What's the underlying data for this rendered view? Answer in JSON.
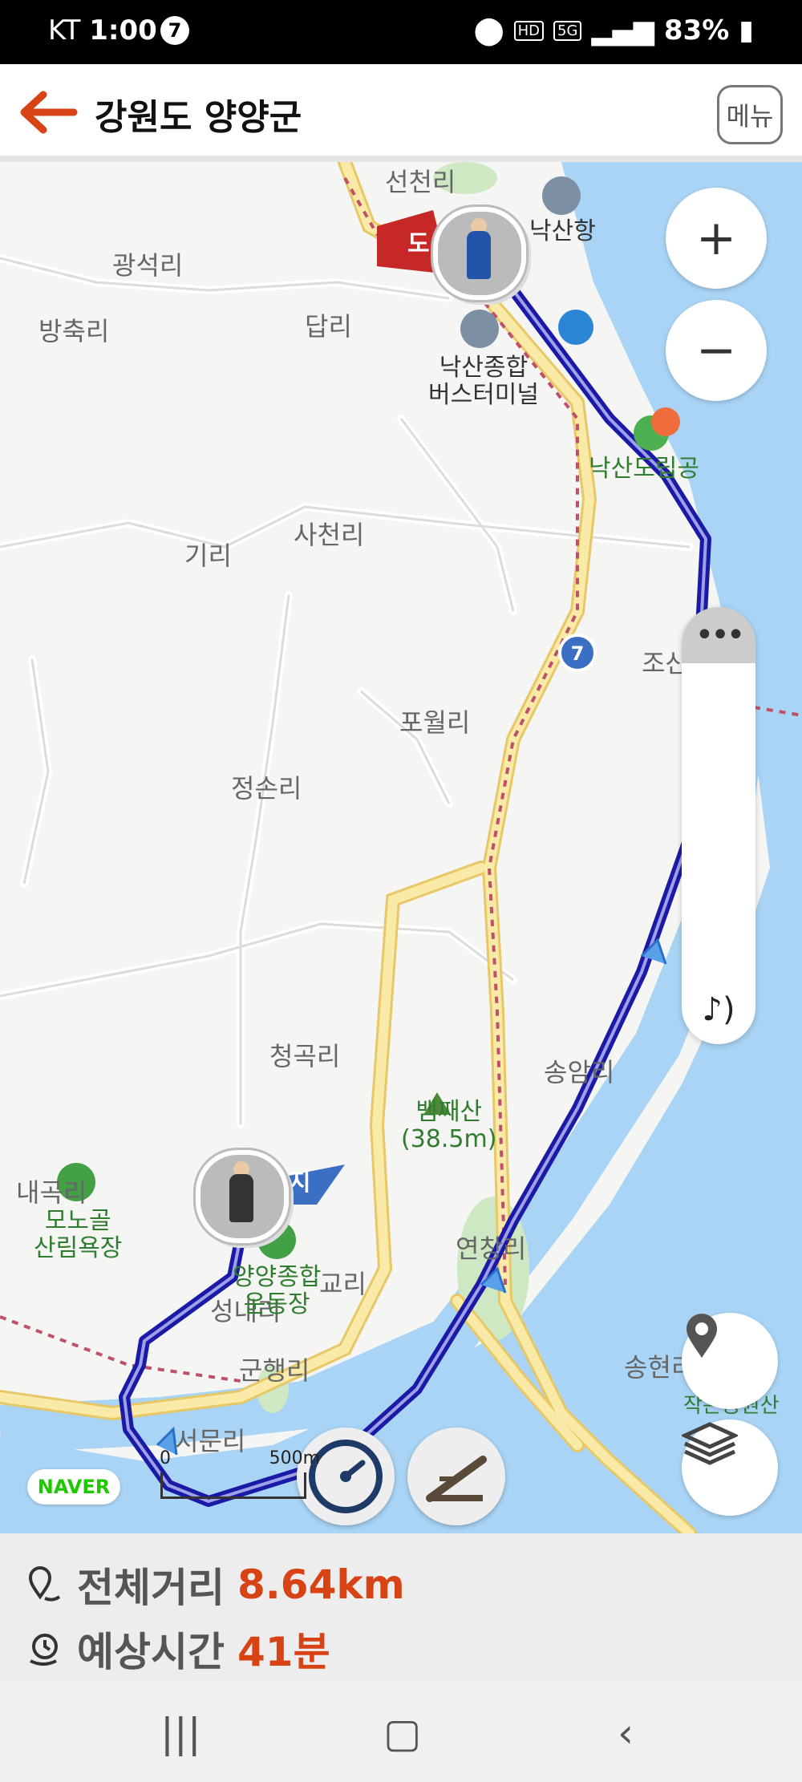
{
  "status": {
    "carrier": "KT",
    "time": "1:00",
    "notif_count": "7",
    "net_hd": "HD",
    "net_5g": "5G",
    "battery": "83%"
  },
  "header": {
    "title": "강원도 양양군",
    "menu_label": "메뉴"
  },
  "map": {
    "places": {
      "seoncheonri": "선천리",
      "gwangseokri": "광석리",
      "bangchukri": "방축리",
      "dapri": "답리",
      "giri": "기리",
      "sacheonri": "사천리",
      "powolri": "포월리",
      "jeongsonri": "정손리",
      "cheonggokri": "청곡리",
      "songamri": "송암리",
      "naegokri": "내곡리",
      "gyori": "교리",
      "gunhaengri": "군행리",
      "seomunri": "서문리",
      "yeonchangri": "연창리",
      "songhyeonri": "송현리",
      "josan": "조산",
      "seongnaeri": "성내리"
    },
    "pois": {
      "naksan_port": "낙산항",
      "terminal_line1": "낙산종합",
      "terminal_line2": "버스터미널",
      "naksan_park": "낙산도립공",
      "mountain_line1": "뱀째산",
      "mountain_line2": "(38.5m)",
      "forest_line1": "모노골",
      "forest_line2": "산림욕장",
      "stadium_line1": "양양종합",
      "stadium_line2": "운동장",
      "small_park": "작은공원산"
    },
    "road_number": "7",
    "start_flag": "도",
    "end_flag": "지",
    "naver_logo": "NAVER",
    "scale_zero": "0",
    "scale_value": "500m"
  },
  "controls": {
    "zoom_in": "+",
    "zoom_out": "−",
    "panel_more": "•••"
  },
  "summary": {
    "distance_label": "전체거리",
    "distance_value": "8.64km",
    "time_label": "예상시간",
    "time_value": "41분"
  },
  "colors": {
    "accent": "#d84315",
    "route": "#1a1aa6",
    "water": "#a9d4f5",
    "road": "#f5dc8a"
  }
}
